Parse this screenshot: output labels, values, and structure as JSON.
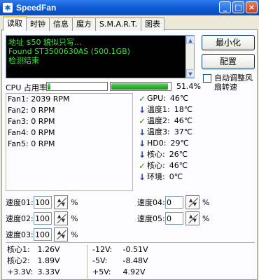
{
  "window": {
    "title": "SpeedFan",
    "app_icon_glyph": "✱"
  },
  "title_buttons": {
    "minimize": "_",
    "maximize": "□",
    "close": "×"
  },
  "tabs": [
    "读取",
    "时钟",
    "信息",
    "魔方",
    "S.M.A.R.T.",
    "图表"
  ],
  "log": {
    "lines": [
      "地址 $50 貌似只写...",
      "Found ST3500630AS (500.1GB)",
      "检测结束"
    ],
    "scroll_up": "▲",
    "scroll_down": "▼"
  },
  "buttons": {
    "minimize": "最小化",
    "config": "配置"
  },
  "auto_adjust": {
    "label": "自动调整风扇转速",
    "checked": false
  },
  "cpu": {
    "label": "CPU 占用率",
    "bar1_fill_percent": 5,
    "bar2_fill_percent": 97,
    "percent_text": "51.4%"
  },
  "fans": [
    "Fan1: 2039 RPM",
    "Fan2: 0 RPM",
    "Fan3: 0 RPM",
    "Fan4: 0 RPM",
    "Fan5: 0 RPM"
  ],
  "temps": [
    {
      "icon": "check-icon",
      "glyph": "✓",
      "label": "GPU:",
      "value": "46℃"
    },
    {
      "icon": "arrow-down-icon",
      "glyph": "↓",
      "label": "温度1:",
      "value": "18℃"
    },
    {
      "icon": "check-icon",
      "glyph": "✓",
      "label": "温度2:",
      "value": "46℃"
    },
    {
      "icon": "arrow-down-icon",
      "glyph": "↓",
      "label": "温度3:",
      "value": "37℃"
    },
    {
      "icon": "arrow-down-icon",
      "glyph": "↓",
      "label": "HD0:",
      "value": "29℃"
    },
    {
      "icon": "arrow-down-icon",
      "glyph": "↓",
      "label": "核心:",
      "value": "26℃"
    },
    {
      "icon": "check-icon",
      "glyph": "✓",
      "label": "核心:",
      "value": "46℃"
    },
    {
      "icon": "arrow-down-icon",
      "glyph": "↓",
      "label": "环境:",
      "value": "0℃"
    }
  ],
  "speeds": [
    {
      "label": "速度01:",
      "value": "100",
      "unit": "%"
    },
    {
      "label": "速度02:",
      "value": "100",
      "unit": "%"
    },
    {
      "label": "速度03:",
      "value": "100",
      "unit": "%"
    },
    {
      "label": "速度04:",
      "value": "0",
      "unit": "%"
    },
    {
      "label": "速度05:",
      "value": "0",
      "unit": "%"
    }
  ],
  "spin_glyphs": {
    "up": "▲",
    "down": "▼"
  },
  "voltages": {
    "left": [
      {
        "label": "核心1:",
        "value": "1.26V"
      },
      {
        "label": "核心2:",
        "value": "1.89V"
      },
      {
        "label": "+3.3V:",
        "value": "3.33V"
      }
    ],
    "right": [
      {
        "label": "-12V:",
        "value": "-0.51V"
      },
      {
        "label": "-5V:",
        "value": "-8.48V"
      },
      {
        "label": "+5V:",
        "value": "4.92V"
      }
    ]
  }
}
